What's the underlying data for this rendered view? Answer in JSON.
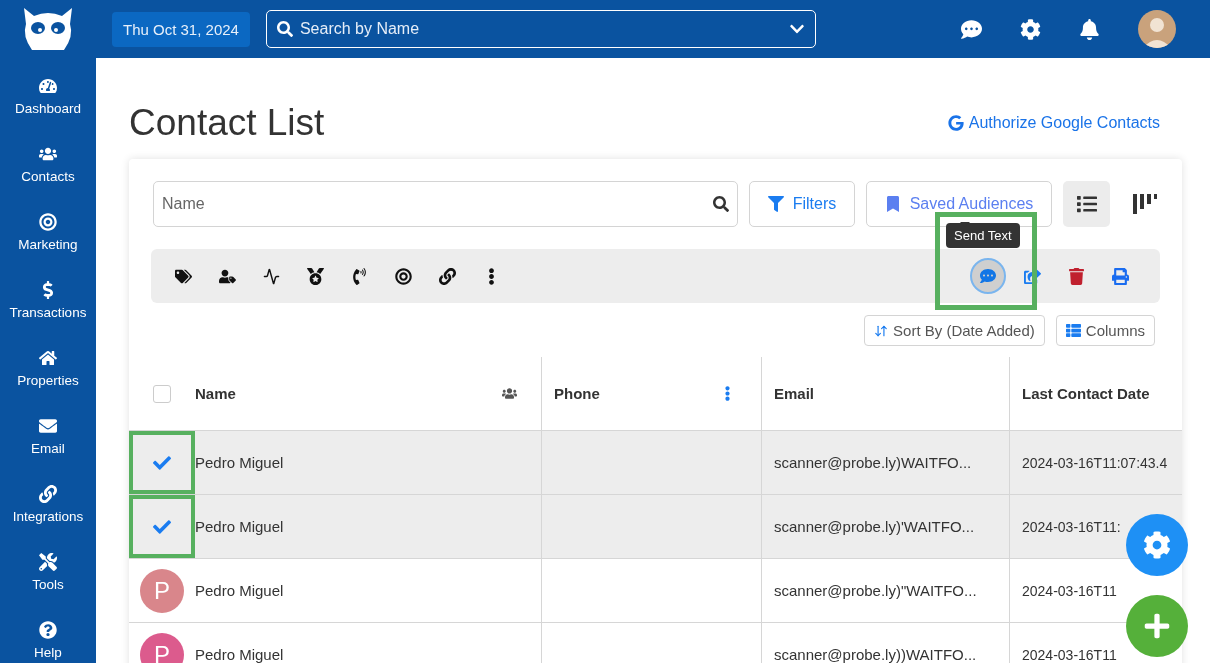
{
  "header": {
    "date": "Thu Oct 31, 2024",
    "search_placeholder": "Search by Name"
  },
  "sidebar": {
    "items": [
      {
        "label": "Dashboard"
      },
      {
        "label": "Contacts"
      },
      {
        "label": "Marketing"
      },
      {
        "label": "Transactions"
      },
      {
        "label": "Properties"
      },
      {
        "label": "Email"
      },
      {
        "label": "Integrations"
      },
      {
        "label": "Tools"
      },
      {
        "label": "Help"
      }
    ]
  },
  "page": {
    "title": "Contact List",
    "google_link": "Authorize Google Contacts"
  },
  "filters": {
    "name_placeholder": "Name",
    "filters_button": "Filters",
    "audiences_button": "Saved Audiences",
    "list_view_selected": true
  },
  "actions": {
    "tooltip": "Send Text",
    "highlighted": true
  },
  "sort": {
    "sort_button": "Sort By (Date Added)",
    "columns_button": "Columns"
  },
  "table": {
    "select_all_checked": false,
    "columns": [
      {
        "label": "Name"
      },
      {
        "label": "Phone"
      },
      {
        "label": "Email"
      },
      {
        "label": "Last Contact Date"
      }
    ],
    "rows": [
      {
        "checked": true,
        "name": "Pedro Miguel",
        "email": "scanner@probe.ly)WAITFO...",
        "date": "2024-03-16T11:07:43.4"
      },
      {
        "checked": true,
        "name": "Pedro Miguel",
        "email": "scanner@probe.ly)'WAITFO...",
        "date": "2024-03-16T11:"
      },
      {
        "checked": false,
        "avatar": "P",
        "color": "#d9868b",
        "name": "Pedro Miguel",
        "email": "scanner@probe.ly)\"WAITFO...",
        "date": "2024-03-16T11"
      },
      {
        "checked": false,
        "avatar": "P",
        "color": "#dc5b8d",
        "name": "Pedro Miguel",
        "email": "scanner@probe.ly))WAITFO...",
        "date": "2024-03-16T11"
      }
    ]
  }
}
